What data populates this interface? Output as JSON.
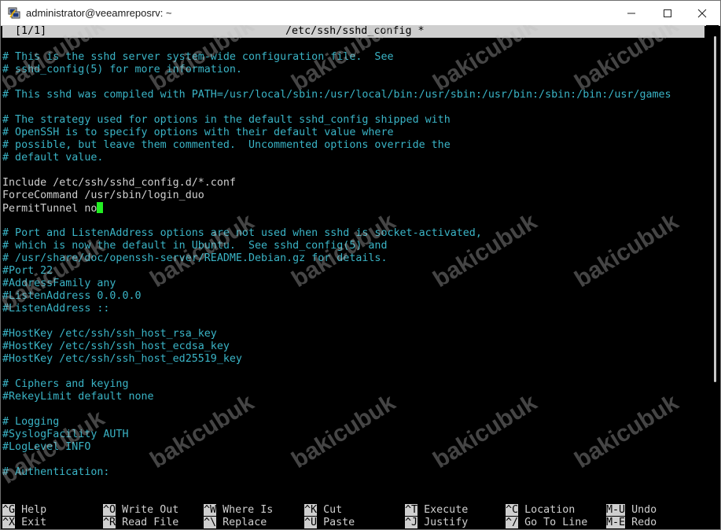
{
  "window": {
    "title": "administrator@veeamreposrv: ~",
    "icons": {
      "app": "putty-icon",
      "minimize": "minimize-icon",
      "maximize": "maximize-icon",
      "close": "close-icon"
    }
  },
  "nano": {
    "buffer_indicator": "[1/1]",
    "filename": "/etc/ssh/sshd_config *",
    "lines": [
      {
        "t": "# This is the sshd server system-wide configuration file.  See",
        "c": "comment"
      },
      {
        "t": "# sshd_config(5) for more information.",
        "c": "comment"
      },
      {
        "t": "",
        "c": "plain"
      },
      {
        "t": "# This sshd was compiled with PATH=/usr/local/sbin:/usr/local/bin:/usr/sbin:/usr/bin:/sbin:/bin:/usr/games",
        "c": "comment"
      },
      {
        "t": "",
        "c": "plain"
      },
      {
        "t": "# The strategy used for options in the default sshd_config shipped with",
        "c": "comment"
      },
      {
        "t": "# OpenSSH is to specify options with their default value where",
        "c": "comment"
      },
      {
        "t": "# possible, but leave them commented.  Uncommented options override the",
        "c": "comment"
      },
      {
        "t": "# default value.",
        "c": "comment"
      },
      {
        "t": "",
        "c": "plain"
      },
      {
        "t": "Include /etc/ssh/sshd_config.d/*.conf",
        "c": "plain"
      },
      {
        "t": "ForceCommand /usr/sbin/login_duo",
        "c": "plain"
      },
      {
        "t": "PermitTunnel no",
        "c": "plain",
        "cursor": true
      },
      {
        "t": "",
        "c": "plain"
      },
      {
        "t": "# Port and ListenAddress options are not used when sshd is socket-activated,",
        "c": "comment"
      },
      {
        "t": "# which is now the default in Ubuntu.  See sshd_config(5) and",
        "c": "comment"
      },
      {
        "t": "# /usr/share/doc/openssh-server/README.Debian.gz for details.",
        "c": "comment"
      },
      {
        "t": "#Port 22",
        "c": "comment"
      },
      {
        "t": "#AddressFamily any",
        "c": "comment"
      },
      {
        "t": "#ListenAddress 0.0.0.0",
        "c": "comment"
      },
      {
        "t": "#ListenAddress ::",
        "c": "comment"
      },
      {
        "t": "",
        "c": "plain"
      },
      {
        "t": "#HostKey /etc/ssh/ssh_host_rsa_key",
        "c": "comment"
      },
      {
        "t": "#HostKey /etc/ssh/ssh_host_ecdsa_key",
        "c": "comment"
      },
      {
        "t": "#HostKey /etc/ssh/ssh_host_ed25519_key",
        "c": "comment"
      },
      {
        "t": "",
        "c": "plain"
      },
      {
        "t": "# Ciphers and keying",
        "c": "comment"
      },
      {
        "t": "#RekeyLimit default none",
        "c": "comment"
      },
      {
        "t": "",
        "c": "plain"
      },
      {
        "t": "# Logging",
        "c": "comment"
      },
      {
        "t": "#SyslogFacility AUTH",
        "c": "comment"
      },
      {
        "t": "#LogLevel INFO",
        "c": "comment"
      },
      {
        "t": "",
        "c": "plain"
      },
      {
        "t": "# Authentication:",
        "c": "comment"
      }
    ],
    "shortcuts_row1": [
      {
        "key": "^G",
        "label": "Help"
      },
      {
        "key": "^O",
        "label": "Write Out"
      },
      {
        "key": "^W",
        "label": "Where Is"
      },
      {
        "key": "^K",
        "label": "Cut"
      },
      {
        "key": "^T",
        "label": "Execute"
      },
      {
        "key": "^C",
        "label": "Location"
      },
      {
        "key": "M-U",
        "label": "Undo"
      }
    ],
    "shortcuts_row2": [
      {
        "key": "^X",
        "label": "Exit"
      },
      {
        "key": "^R",
        "label": "Read File"
      },
      {
        "key": "^\\",
        "label": "Replace"
      },
      {
        "key": "^U",
        "label": "Paste"
      },
      {
        "key": "^J",
        "label": "Justify"
      },
      {
        "key": "^/",
        "label": "Go To Line"
      },
      {
        "key": "M-E",
        "label": "Redo"
      }
    ]
  },
  "watermark": {
    "text": "bakicubuk"
  },
  "colors": {
    "comment": "#3ab4c6",
    "text": "#cfcfcf",
    "cursor": "#22ee22",
    "background": "#000000"
  }
}
